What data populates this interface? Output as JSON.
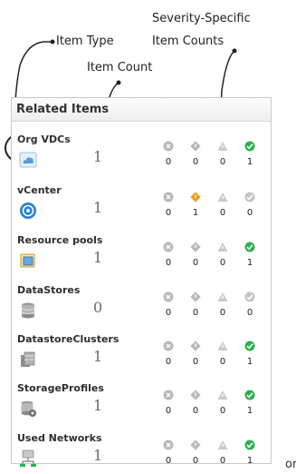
{
  "annotations": {
    "item_type": "Item Type",
    "item_count": "Item Count",
    "severity_line1": "Severity-Specific",
    "severity_line2": "Item Counts"
  },
  "panel": {
    "title": "Related Items",
    "severity_icons": [
      "critical-gray-icon",
      "error-gray-icon",
      "warning-gray-icon",
      "ok-icon"
    ],
    "rows": [
      {
        "name": "Org VDCs",
        "count": "1",
        "icon": "cloud-icon",
        "severities": [
          "0",
          "0",
          "0",
          "1"
        ],
        "sev_active": [
          false,
          false,
          false,
          true
        ]
      },
      {
        "name": "vCenter",
        "count": "1",
        "icon": "vcenter-icon",
        "severities": [
          "0",
          "1",
          "0",
          "0"
        ],
        "sev_active": [
          false,
          true,
          false,
          false
        ]
      },
      {
        "name": "Resource pools",
        "count": "1",
        "icon": "resource-pool-icon",
        "severities": [
          "0",
          "0",
          "0",
          "1"
        ],
        "sev_active": [
          false,
          false,
          false,
          true
        ]
      },
      {
        "name": "DataStores",
        "count": "0",
        "icon": "datastore-icon",
        "severities": [
          "0",
          "0",
          "0",
          "0"
        ],
        "sev_active": [
          false,
          false,
          false,
          false
        ]
      },
      {
        "name": "DatastoreClusters",
        "count": "1",
        "icon": "datastore-cluster-icon",
        "severities": [
          "0",
          "0",
          "0",
          "1"
        ],
        "sev_active": [
          false,
          false,
          false,
          true
        ]
      },
      {
        "name": "StorageProfiles",
        "count": "1",
        "icon": "storage-profile-icon",
        "severities": [
          "0",
          "0",
          "0",
          "1"
        ],
        "sev_active": [
          false,
          false,
          false,
          true
        ]
      },
      {
        "name": "Used Networks",
        "count": "1",
        "icon": "network-icon",
        "severities": [
          "0",
          "0",
          "0",
          "1"
        ],
        "sev_active": [
          false,
          false,
          false,
          true
        ]
      }
    ]
  },
  "trailing_text": "or",
  "colors": {
    "ok": "#2bb24c",
    "error": "#f39a1e",
    "inactive": "#b9b9b9",
    "count": "#6a6a6a",
    "vcenter_blue": "#2a7fd4"
  }
}
